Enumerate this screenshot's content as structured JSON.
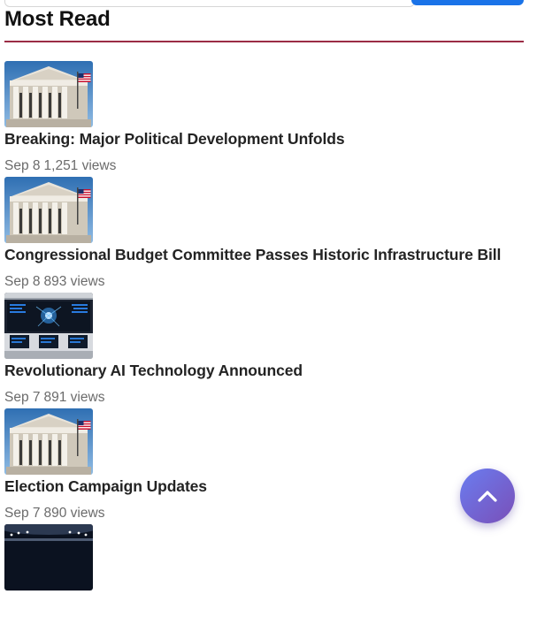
{
  "section": {
    "title": "Most Read"
  },
  "articles": [
    {
      "title": "Breaking: Major Political Development Unfolds",
      "date": "Sep 8",
      "views": "1,251 views",
      "thumbnail": "capitol-building"
    },
    {
      "title": "Congressional Budget Committee Passes Historic Infrastructure Bill",
      "date": "Sep 8",
      "views": "893 views",
      "thumbnail": "capitol-building"
    },
    {
      "title": "Revolutionary AI Technology Announced",
      "date": "Sep 7",
      "views": "891 views",
      "thumbnail": "ai-control-room"
    },
    {
      "title": "Election Campaign Updates",
      "date": "Sep 7",
      "views": "890 views",
      "thumbnail": "capitol-building"
    },
    {
      "thumbnail": "stadium-lights"
    }
  ],
  "scroll_top": {
    "icon": "chevron-up-icon"
  },
  "colors": {
    "accent_rule": "#9b2c45",
    "search_button": "#1a73e8",
    "scroll_button_start": "#6a7df0",
    "scroll_button_end": "#7a4fb8"
  }
}
